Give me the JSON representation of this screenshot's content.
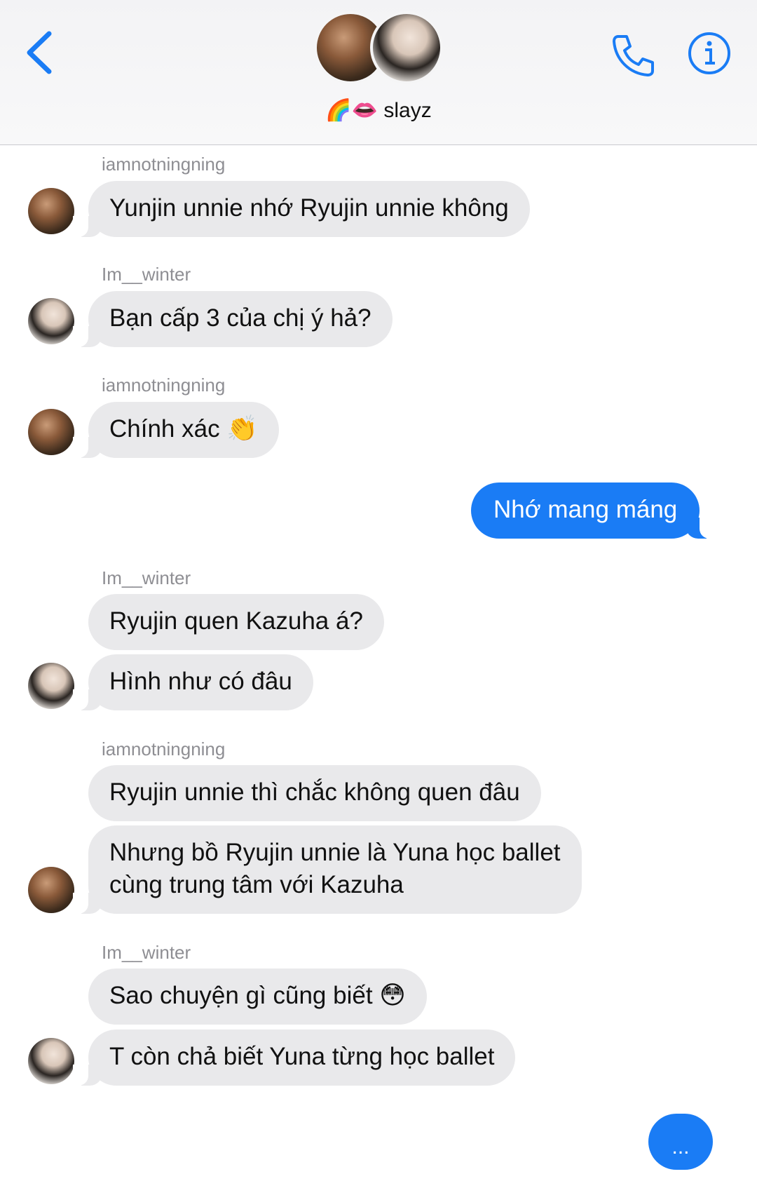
{
  "header": {
    "title_emoji": "🌈👄",
    "title_text": "slayz",
    "colors": {
      "accent": "#1a7cf5"
    },
    "icons": [
      "chevron-left-icon",
      "phone-icon",
      "info-icon"
    ]
  },
  "messages": [
    {
      "sender": "iamnotningning",
      "text": "Yunjin unnie nhớ Ryujin unnie không"
    },
    {
      "sender": "Im__winter",
      "text": "Bạn cấp 3 của chị ý hả?"
    },
    {
      "sender": "iamnotningning",
      "text": "Chính xác",
      "emoji": "👏"
    },
    {
      "outgoing": true,
      "text": "Nhớ mang máng"
    },
    {
      "sender": "Im__winter",
      "text1": "Ryujin quen Kazuha á?",
      "text2": "Hình như có đâu"
    },
    {
      "sender": "iamnotningning",
      "text1": "Ryujin unnie thì chắc không quen đâu",
      "text2_line1": "Nhưng bồ Ryujin unnie là Yuna học ballet",
      "text2_line2": "cùng trung tâm với Kazuha"
    },
    {
      "sender": "Im__winter",
      "text1": "Sao chuyện gì cũng biết",
      "emoji": "😳",
      "text2": "T còn chả biết Yuna từng học ballet"
    }
  ],
  "typing": "..."
}
